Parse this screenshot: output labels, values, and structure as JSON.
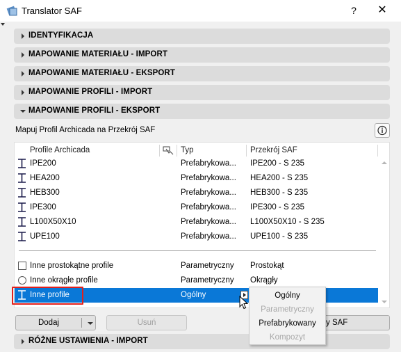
{
  "window": {
    "title": "Translator SAF",
    "help": "?",
    "close": "✕"
  },
  "sections": [
    {
      "label": "IDENTYFIKACJA",
      "expanded": false
    },
    {
      "label": "MAPOWANIE MATERIAŁU - IMPORT",
      "expanded": false
    },
    {
      "label": "MAPOWANIE MATERIAŁU - EKSPORT",
      "expanded": false
    },
    {
      "label": "MAPOWANIE PROFILI - IMPORT",
      "expanded": false
    },
    {
      "label": "MAPOWANIE PROFILI - EKSPORT",
      "expanded": true
    }
  ],
  "bottom_section": {
    "label": "RÓŻNE USTAWIENIA - IMPORT",
    "expanded": false
  },
  "panel": {
    "description": "Mapuj Profil Archicada na Przekrój SAF",
    "info_icon": "info-icon"
  },
  "table": {
    "headers": {
      "profile": "Profile Archicada",
      "type": "Typ",
      "section": "Przekrój SAF"
    },
    "rows": [
      {
        "profile": "IPE200",
        "type": "Prefabrykowa...",
        "section": "IPE200 - S 235",
        "icon": "i-beam-icon"
      },
      {
        "profile": "HEA200",
        "type": "Prefabrykowa...",
        "section": "HEA200 - S 235",
        "icon": "i-beam-icon"
      },
      {
        "profile": "HEB300",
        "type": "Prefabrykowa...",
        "section": "HEB300 - S 235",
        "icon": "i-beam-icon"
      },
      {
        "profile": "IPE300",
        "type": "Prefabrykowa...",
        "section": "IPE300 - S 235",
        "icon": "i-beam-icon"
      },
      {
        "profile": "L100X50X10",
        "type": "Prefabrykowa...",
        "section": "L100X50X10 - S 235",
        "icon": "i-beam-icon"
      },
      {
        "profile": "UPE100",
        "type": "Prefabrykowa...",
        "section": "UPE100 - S 235",
        "icon": "i-beam-icon"
      }
    ],
    "other_rows": [
      {
        "profile": "Inne prostokątne profile",
        "type": "Parametryczny",
        "section": "Prostokąt",
        "icon": "rectangle-icon"
      },
      {
        "profile": "Inne okrągłe profile",
        "type": "Parametryczny",
        "section": "Okrągły",
        "icon": "circle-icon"
      },
      {
        "profile": "Inne profile",
        "type": "Ogólny",
        "section": "",
        "icon": "i-beam-icon",
        "selected": true
      }
    ]
  },
  "buttons": {
    "add": "Dodaj",
    "remove": "Usuń",
    "map_partial": "y SAF"
  },
  "dropdown": {
    "options": [
      {
        "label": "Ogólny",
        "enabled": true
      },
      {
        "label": "Parametryczny",
        "enabled": false
      },
      {
        "label": "Prefabrykowany",
        "enabled": true
      },
      {
        "label": "Kompozyt",
        "enabled": false
      }
    ]
  },
  "colors": {
    "selection": "#0a78d7",
    "highlight_box": "#e3201b",
    "section_bg": "#dcdcdc"
  }
}
